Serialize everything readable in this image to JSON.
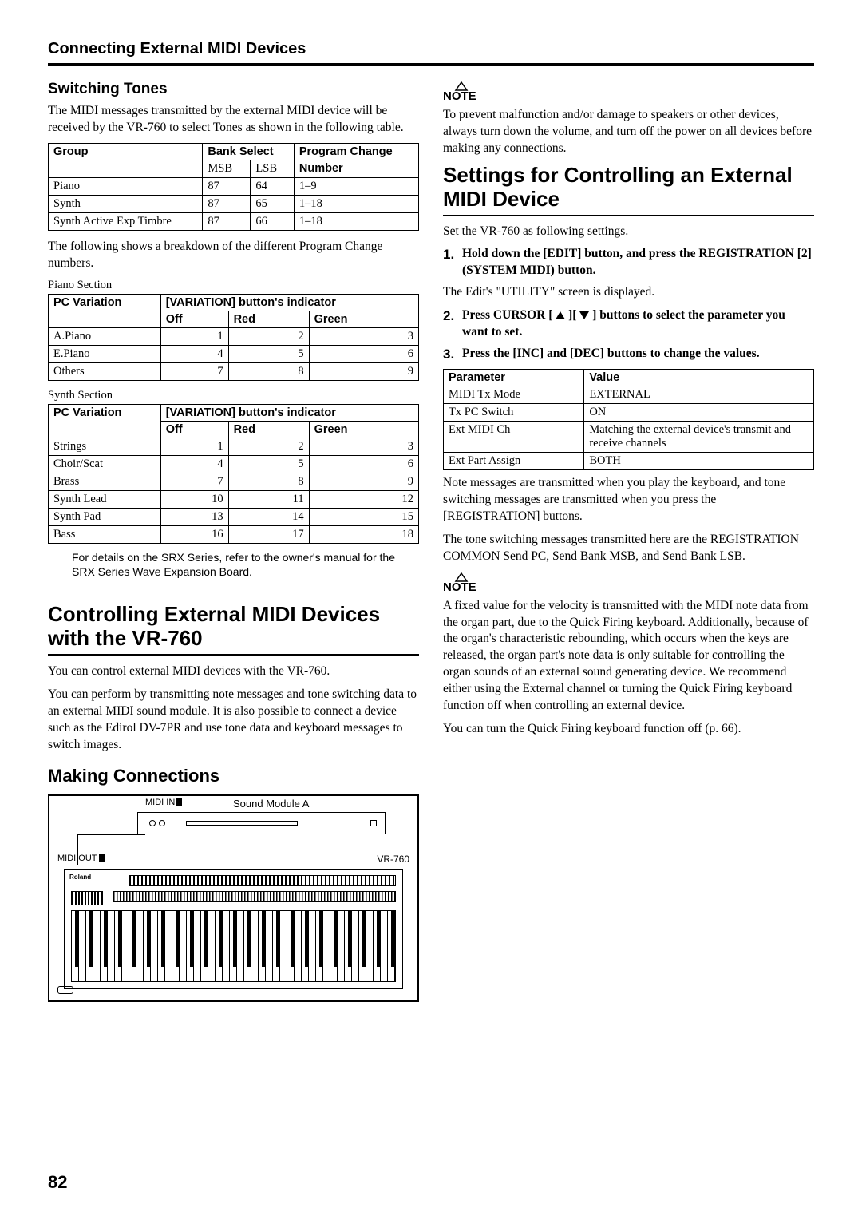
{
  "header": "Connecting External MIDI Devices",
  "left": {
    "h_switching": "Switching Tones",
    "p_switching": "The MIDI messages transmitted by the external MIDI device will be received by the VR-760 to select Tones as shown in the following table.",
    "table1": {
      "head": {
        "group": "Group",
        "bank": "Bank Select",
        "pc": "Program Change",
        "msb": "MSB",
        "lsb": "LSB",
        "num": "Number"
      },
      "rows": [
        {
          "g": "Piano",
          "msb": "87",
          "lsb": "64",
          "pc": "1–9"
        },
        {
          "g": "Synth",
          "msb": "87",
          "lsb": "65",
          "pc": "1–18"
        },
        {
          "g": "Synth Active Exp Timbre",
          "msb": "87",
          "lsb": "66",
          "pc": "1–18"
        }
      ]
    },
    "p_breakdown": "The following shows a breakdown of the different Program Change numbers.",
    "piano_label": "Piano Section",
    "table2": {
      "head": {
        "pcv": "PC Variation",
        "var": "[VARIATION] button's indicator",
        "off": "Off",
        "red": "Red",
        "green": "Green"
      },
      "rows": [
        {
          "n": "A.Piano",
          "a": "1",
          "b": "2",
          "c": "3"
        },
        {
          "n": "E.Piano",
          "a": "4",
          "b": "5",
          "c": "6"
        },
        {
          "n": "Others",
          "a": "7",
          "b": "8",
          "c": "9"
        }
      ]
    },
    "synth_label": "Synth Section",
    "table3": {
      "head": {
        "pcv": "PC Variation",
        "var": "[VARIATION] button's indicator",
        "off": "Off",
        "red": "Red",
        "green": "Green"
      },
      "rows": [
        {
          "n": "Strings",
          "a": "1",
          "b": "2",
          "c": "3"
        },
        {
          "n": "Choir/Scat",
          "a": "4",
          "b": "5",
          "c": "6"
        },
        {
          "n": "Brass",
          "a": "7",
          "b": "8",
          "c": "9"
        },
        {
          "n": "Synth Lead",
          "a": "10",
          "b": "11",
          "c": "12"
        },
        {
          "n": "Synth Pad",
          "a": "13",
          "b": "14",
          "c": "15"
        },
        {
          "n": "Bass",
          "a": "16",
          "b": "17",
          "c": "18"
        }
      ]
    },
    "srx_note": "For details on the SRX Series, refer to the owner's manual for the SRX Series Wave Expansion Board.",
    "h_control": "Controlling External MIDI Devices with the VR-760",
    "p_control1": "You can control external MIDI devices with the VR-760.",
    "p_control2": "You can perform by transmitting note messages and tone switching data to an external MIDI sound module. It is also possible to connect a device such as the Edirol DV-7PR and use tone data and keyboard messages to switch images.",
    "h_making": "Making Connections",
    "diagram": {
      "midi_in": "MIDI IN",
      "sound_module": "Sound Module A",
      "midi_out": "MIDI OUT",
      "vr": "VR-760"
    }
  },
  "right": {
    "note1": "To prevent malfunction and/or damage to speakers or other devices, always turn down the volume, and turn off the power on all devices before making any connections.",
    "h_settings": "Settings for Controlling an External MIDI Device",
    "p_set": "Set the VR-760 as following settings.",
    "step1": "Hold down the [EDIT] button, and press the REGISTRATION [2] (SYSTEM MIDI) button.",
    "p_utility": "The Edit's \"UTILITY\" screen is displayed.",
    "step2a": "Press CURSOR [ ",
    "step2b": " ][ ",
    "step2c": " ] buttons to select the parameter you want to set.",
    "step3": "Press the [INC] and [DEC] buttons to change the values.",
    "table4": {
      "head": {
        "param": "Parameter",
        "val": "Value"
      },
      "rows": [
        {
          "p": "MIDI Tx Mode",
          "v": "EXTERNAL"
        },
        {
          "p": "Tx PC Switch",
          "v": "ON"
        },
        {
          "p": "Ext MIDI Ch",
          "v": "Matching the external device's transmit and receive channels"
        },
        {
          "p": "Ext Part Assign",
          "v": "BOTH"
        }
      ]
    },
    "p_notemsg": "Note messages are transmitted when you play the keyboard, and tone switching messages are transmitted when you press the [REGISTRATION] buttons.",
    "p_tonemsg": "The tone switching messages transmitted here are the REGISTRATION COMMON Send PC, Send Bank MSB, and Send Bank LSB.",
    "note2": "A fixed value for the velocity is transmitted with the MIDI note data from the organ part, due to the Quick Firing keyboard. Additionally, because of the organ's characteristic rebounding, which occurs when the keys are released, the organ part's note data is only suitable for controlling the organ sounds of an external sound generating device. We recommend either using the External channel or turning the Quick Firing keyboard function off when controlling an external device.",
    "p_qf": "You can turn the Quick Firing keyboard function off (p. 66)."
  },
  "page_num": "82",
  "note_label": "NOTE"
}
